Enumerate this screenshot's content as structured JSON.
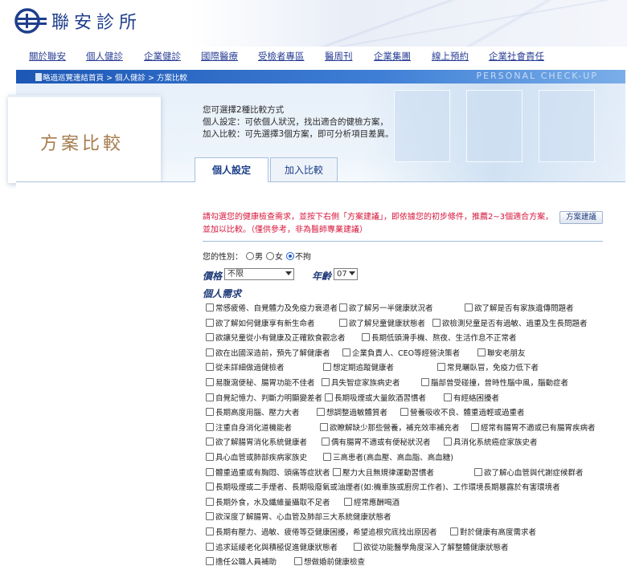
{
  "header": {
    "brand": "聯安診所"
  },
  "nav": [
    {
      "label": "關於聯安"
    },
    {
      "label": "個人健診"
    },
    {
      "label": "企業健診"
    },
    {
      "label": "國際醫療"
    },
    {
      "label": "受檢者專區"
    },
    {
      "label": "醫周刊"
    },
    {
      "label": "企業集團"
    },
    {
      "label": "線上預約"
    },
    {
      "label": "企業社會責任"
    }
  ],
  "breadcrumb": {
    "text": "略過巡覽連結首頁 > 個人健診 > 方案比較",
    "banner_en": "PERSONAL CHECK-UP"
  },
  "page_title": "方案比較",
  "intro": {
    "line1": "您可選擇2種比較方式",
    "line2": "個人設定：可依個人狀況，找出適合的健檢方案，",
    "line3": "加入比較：可先選擇3個方案，即可分析項目差異。"
  },
  "tabs": {
    "personal": "個人設定",
    "compare": "加入比較"
  },
  "notice": "請勾選您的健康檢查需求，並按下右側「方案建議」，即依據您的初步條件，推薦2~3個適合方案，並加以比較。（僅供參考，非為醫師專業建議）",
  "plan_button": "方案建議",
  "gender": {
    "label": "您的性別：",
    "male": "男",
    "female": "女",
    "none": "不拘",
    "selected": "不拘"
  },
  "price": {
    "label": "價格",
    "value": "不限"
  },
  "age": {
    "label": "年齡",
    "value": "07"
  },
  "needs_title": "個人需求",
  "needs_rows": [
    [
      "常感疲倦、自覺體力及免疫力衰退者",
      "欲了解另一半健康狀況者",
      "欲了解是否有家族遺傳問題者"
    ],
    [
      "欲了解如何健康享有新生命者",
      "欲了解兒童健康狀態者",
      "欲檢測兒童是否有過敏、過重及生長問題者"
    ],
    [
      "欲讓兒童從小有健康及正確飲食觀念者",
      "長期低頭滑手機、熬夜、生活作息不正常者"
    ],
    [
      "欲在出國深造前，預先了解健康者",
      "企業負責人、CEO等經營決策者",
      "聯安老朋友"
    ],
    [
      "從未詳細做過健檢者",
      "想定期追蹤健康者",
      "常見曬臥冒，免疫力低下者"
    ],
    [
      "易腹瀉便秘、腸胃功能不佳者",
      "具失智症家族病史者",
      "腦部曾受碰撞，曾時性腦中風，腦動症者"
    ],
    [
      "自覺記憶力、判斷力明顯變差者",
      "長期吸煙或大量飲酒習慣者",
      "有經絡困擾者"
    ],
    [
      "長期高度用腦、壓力大者",
      "想調整過敏體質者",
      "營養吸收不良、體重過輕或過重者"
    ],
    [
      "注重自身消化道機能者",
      "欲瞭解缺少那些營養，補充效率補充者",
      "經常有腸胃不適或已有腸胃疾病者"
    ],
    [
      "欲了解腸胃消化系統健康者",
      "偶有腸胃不適或有便秘狀況者",
      "具消化系統癌症家族史者"
    ],
    [
      "具心血管或肺部疾病家族史",
      "三高患者(高血壓、高血脂、高血糖)"
    ],
    [
      "體重過重或有胸悶、頭痛等症狀者",
      "壓力大且無規律運動習慣者",
      "欲了解心血管與代謝症候群者"
    ],
    [
      "長期吸煙或二手煙者、長期吸廢氣或油煙者(如:機車族或廚房工作者)、工作環境長期暴露於有害環境者"
    ],
    [
      "長期外食，水及纖維量攝取不足者",
      "經常應酬喝酒"
    ],
    [
      "欲深度了解腸胃、心血管及肺部三大系統健康狀態者"
    ],
    [
      "長期有壓力、過敏、疲倦等亞健康困擾，希望追根究底找出原因者",
      "對於健康有高度需求者"
    ],
    [
      "追求延緩老化與積極促進健康狀態者",
      "欲從功能醫學角度深入了解整體健康狀態者"
    ],
    [
      "擔任公職人員補助",
      "想做婚前健康檢查"
    ]
  ]
}
